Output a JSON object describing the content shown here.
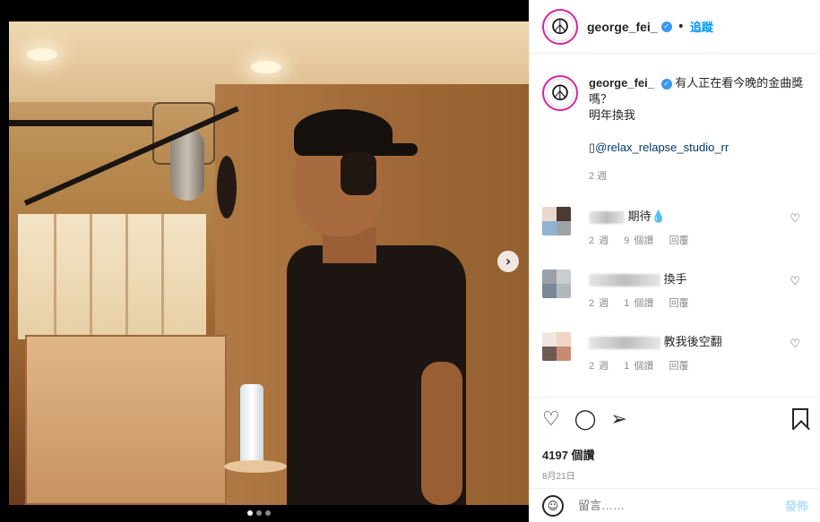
{
  "post": {
    "username": "george_fei_",
    "follow_label": "追蹤",
    "caption_line1": "有人正在看今晚的金曲獎嗎？",
    "caption_line2": "明年換我",
    "mention": "@relax_relapse_studio_rr",
    "caption_age": "2 週",
    "likes": "4197 個讚",
    "date": "8月21日"
  },
  "comments": [
    {
      "text": "期待",
      "age": "2 週",
      "likes": "9 個讚",
      "reply": "回覆"
    },
    {
      "text": "換手",
      "age": "2 週",
      "likes": "1 個讚",
      "reply": "回覆"
    },
    {
      "text": "教我後空翻",
      "age": "2 週",
      "likes": "1 個讚",
      "reply": "回覆"
    }
  ],
  "composer": {
    "placeholder": "留言……",
    "post_label": "發佈"
  },
  "colors": {
    "accent": "#0095f6",
    "verified": "#3897f0"
  },
  "icons": [
    "peace-sign-icon",
    "verified-icon",
    "heart-icon",
    "comment-icon",
    "share-icon",
    "bookmark-icon",
    "emoji-icon",
    "chevron-right-icon"
  ]
}
